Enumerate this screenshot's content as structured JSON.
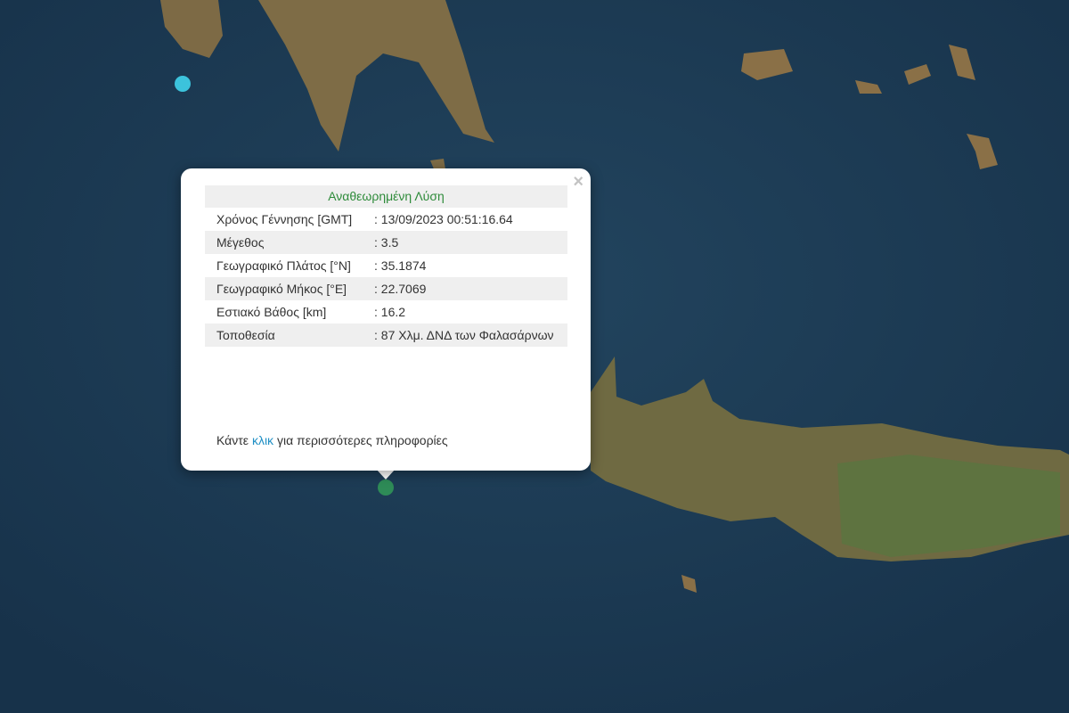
{
  "popup": {
    "title": "Αναθεωρημένη Λύση",
    "close_label": "×",
    "rows": [
      {
        "label": "Χρόνος Γέννησης [GMT]",
        "value": ": 13/09/2023 00:51:16.64"
      },
      {
        "label": "Μέγεθος",
        "value": ": 3.5"
      },
      {
        "label": "Γεωγραφικό Πλάτος [°N]",
        "value": ": 35.1874"
      },
      {
        "label": "Γεωγραφικό Μήκος [°E]",
        "value": ": 22.7069"
      },
      {
        "label": "Εστιακό Βάθος [km]",
        "value": ": 16.2"
      },
      {
        "label": "Τοποθεσία",
        "value": ": 87 Χλμ. ΔΝΔ των Φαλασάρνων"
      }
    ],
    "footer_prefix": "Κάντε",
    "footer_link": "κλικ",
    "footer_suffix": "για περισσότερες πληροφορίες"
  },
  "markers": {
    "selected_color": "#2e8b57",
    "other_color": "#3cc3dc"
  }
}
